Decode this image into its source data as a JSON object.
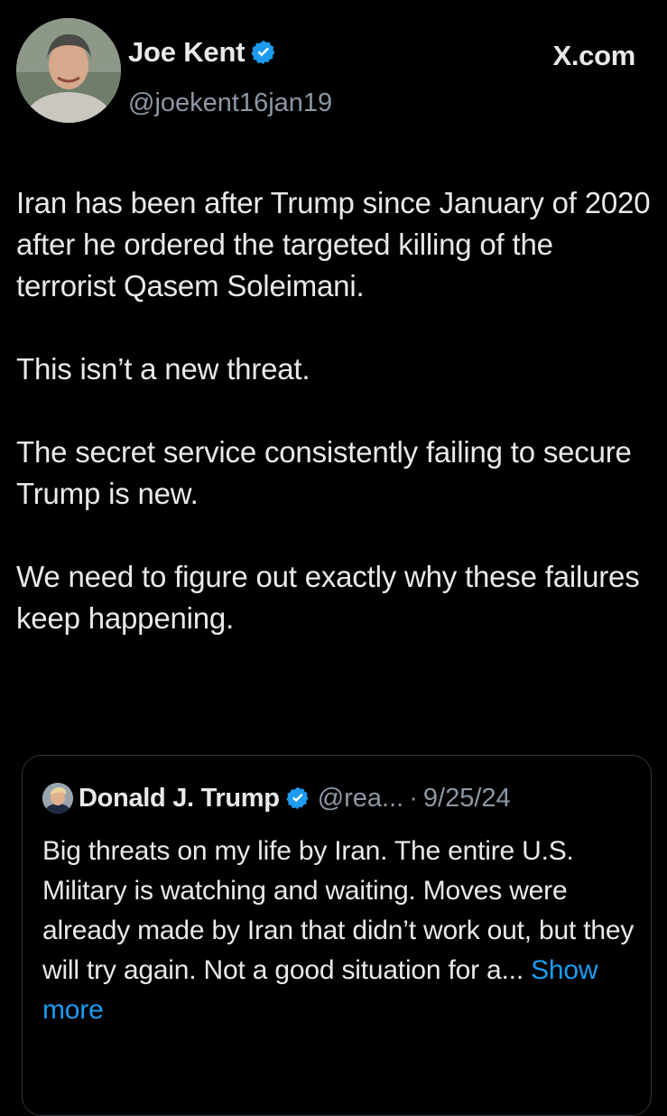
{
  "author": {
    "display_name": "Joe Kent",
    "handle": "@joekent16jan19",
    "verified_color": "#1d9bf0"
  },
  "brand": {
    "label": "X.com"
  },
  "tweet": {
    "paragraphs": [
      "Iran has been after Trump since January of 2020 after he ordered the targeted killing of the terrorist Qasem Soleimani.",
      "This isn’t a new threat.",
      "The secret service consistently failing to secure Trump is new.",
      "We need to figure out exactly why these failures keep happening."
    ]
  },
  "quoted_tweet": {
    "display_name": "Donald J. Trump",
    "handle": "@rea...",
    "separator": "·",
    "date": "9/25/24",
    "text": "Big threats on my life by Iran. The entire U.S. Military is watching and waiting. Moves were already made by Iran that didn’t work out, but they will try again. Not a good situation for a...",
    "show_more_label": "Show more",
    "show_more_color": "#1d9bf0"
  }
}
